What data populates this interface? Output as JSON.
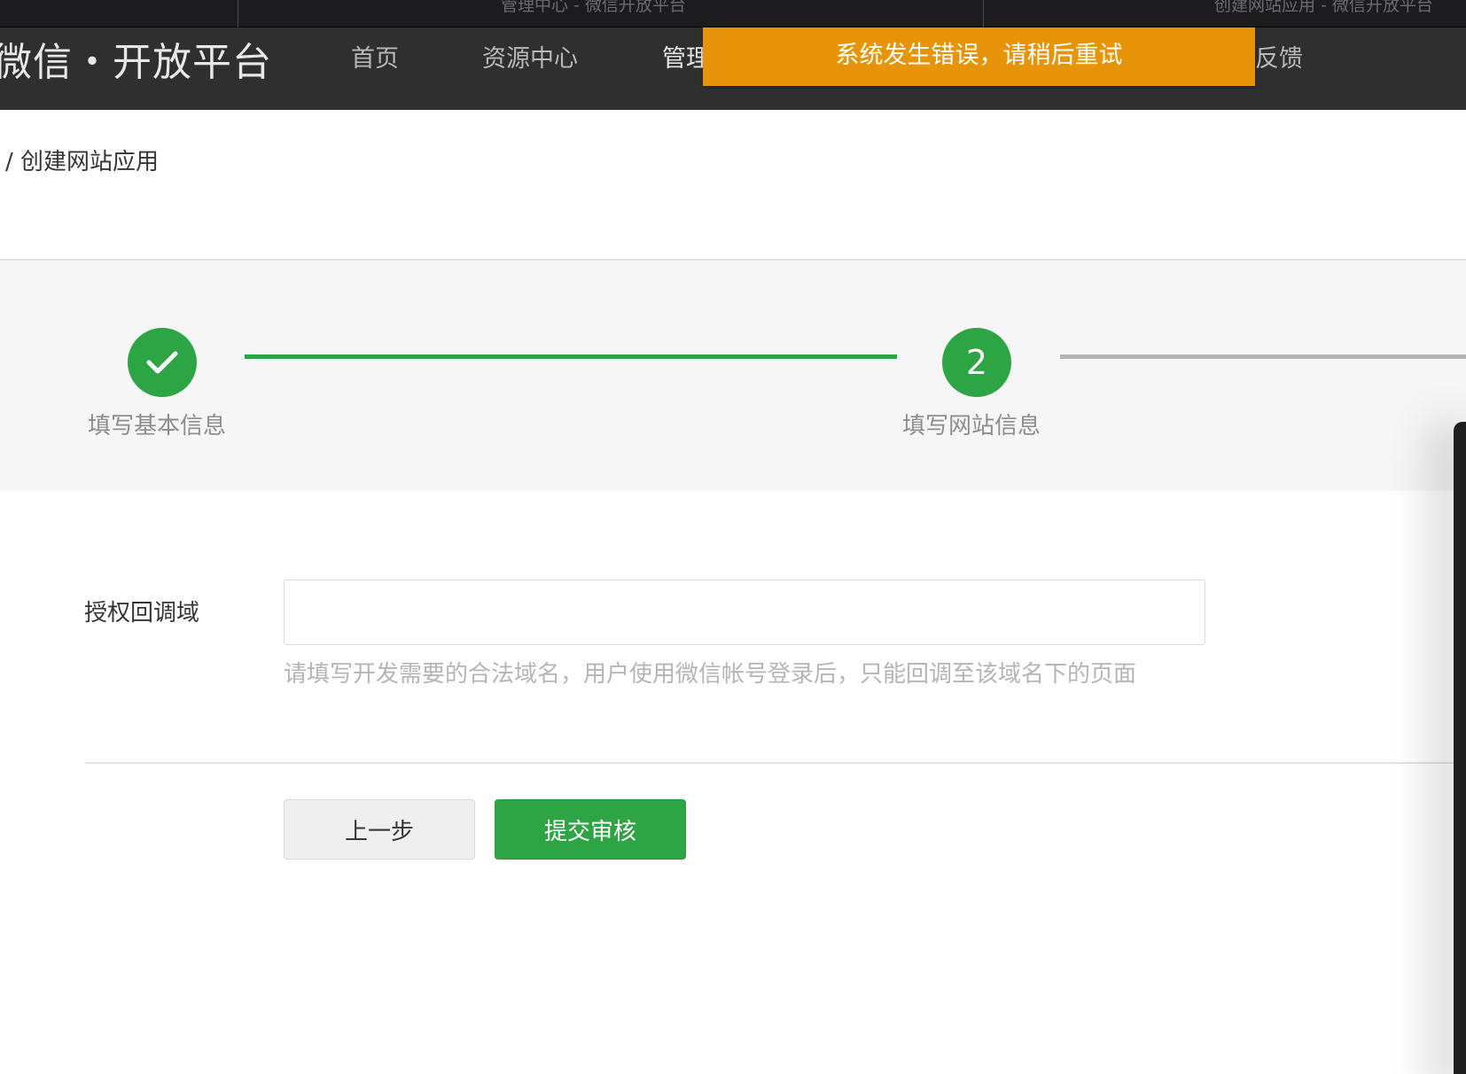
{
  "browser": {
    "tabs": [
      {
        "title": "管理中心 - 微信开放平台"
      },
      {
        "title": "创建网站应用 - 微信开放平台"
      }
    ]
  },
  "header": {
    "logo": "微信・开放平台",
    "nav": {
      "home": "首页",
      "resources": "资源中心",
      "management": "管理",
      "feedback": "反馈"
    }
  },
  "toast": {
    "message": "系统发生错误，请稍后重试",
    "color": "#e8940a"
  },
  "breadcrumb": "/ 创建网站应用",
  "steps": [
    {
      "label": "填写基本信息",
      "status": "done",
      "icon": "check-icon"
    },
    {
      "label": "填写网站信息",
      "status": "current",
      "number": "2"
    }
  ],
  "form": {
    "callback_domain": {
      "label": "授权回调域",
      "value": "",
      "tip": "请填写开发需要的合法域名，用户使用微信帐号登录后，只能回调至该域名下的页面"
    }
  },
  "buttons": {
    "prev": "上一步",
    "submit": "提交审核"
  },
  "colors": {
    "accent": "#2ea544",
    "header_bg": "#2f2f30"
  }
}
